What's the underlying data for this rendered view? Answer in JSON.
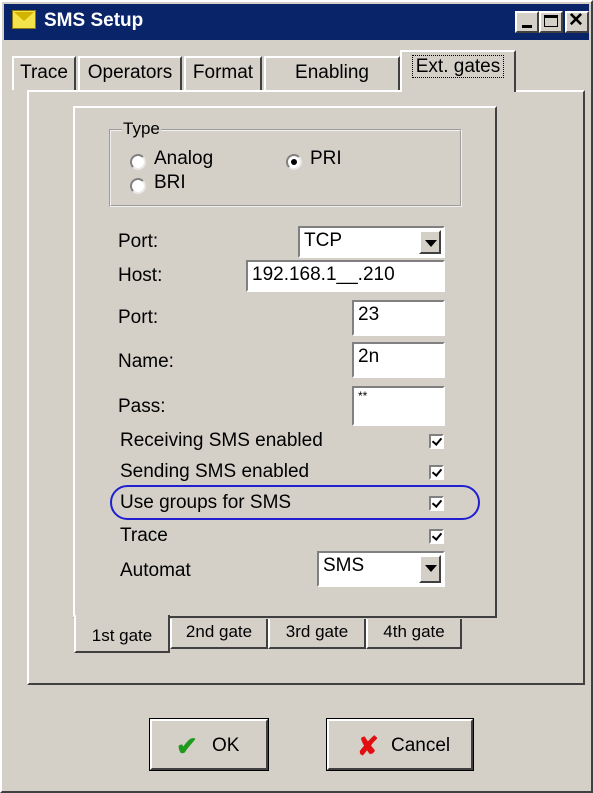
{
  "window": {
    "title": "SMS Setup",
    "icon": "envelope-icon"
  },
  "titlebar_buttons": {
    "minimize_icon": "minimize-icon",
    "maximize_icon": "maximize-icon",
    "close_glyph": "✕"
  },
  "tabs": [
    {
      "label": "Trace",
      "active": false
    },
    {
      "label": "Operators",
      "active": false
    },
    {
      "label": "Format",
      "active": false
    },
    {
      "label": "Enabling",
      "active": false
    },
    {
      "label": "Ext. gates",
      "active": true
    }
  ],
  "type_group": {
    "title": "Type",
    "options": [
      {
        "label": "Analog",
        "checked": false
      },
      {
        "label": "PRI",
        "checked": true
      },
      {
        "label": "BRI",
        "checked": false
      }
    ]
  },
  "form": {
    "port_type_label": "Port:",
    "port_type_value": "TCP",
    "host_label": "Host:",
    "host_value": "192.168.1__.210",
    "port_label": "Port:",
    "port_value": "23",
    "name_label": "Name:",
    "name_value": "2n",
    "pass_label": "Pass:",
    "pass_value": "**"
  },
  "checks": [
    {
      "label": "Receiving SMS enabled",
      "checked": true
    },
    {
      "label": "Sending SMS enabled",
      "checked": true
    },
    {
      "label": "Use groups for SMS",
      "checked": true,
      "highlighted": true
    },
    {
      "label": "Trace",
      "checked": true
    }
  ],
  "automat": {
    "label": "Automat",
    "value": "SMS"
  },
  "gate_tabs": [
    {
      "label": "1st gate",
      "active": true
    },
    {
      "label": "2nd gate",
      "active": false
    },
    {
      "label": "3rd gate",
      "active": false
    },
    {
      "label": "4th gate",
      "active": false
    }
  ],
  "buttons": {
    "ok": {
      "label": "OK",
      "icon": "checkmark-icon",
      "icon_color": "#1f9a1f",
      "glyph": "✔"
    },
    "cancel": {
      "label": "Cancel",
      "icon": "cross-icon",
      "icon_color": "#e01010",
      "glyph": "✘"
    }
  },
  "colors": {
    "face": "#d4d0c8",
    "titlebar": "#0a246a",
    "highlight_oval": "#2020d0"
  }
}
